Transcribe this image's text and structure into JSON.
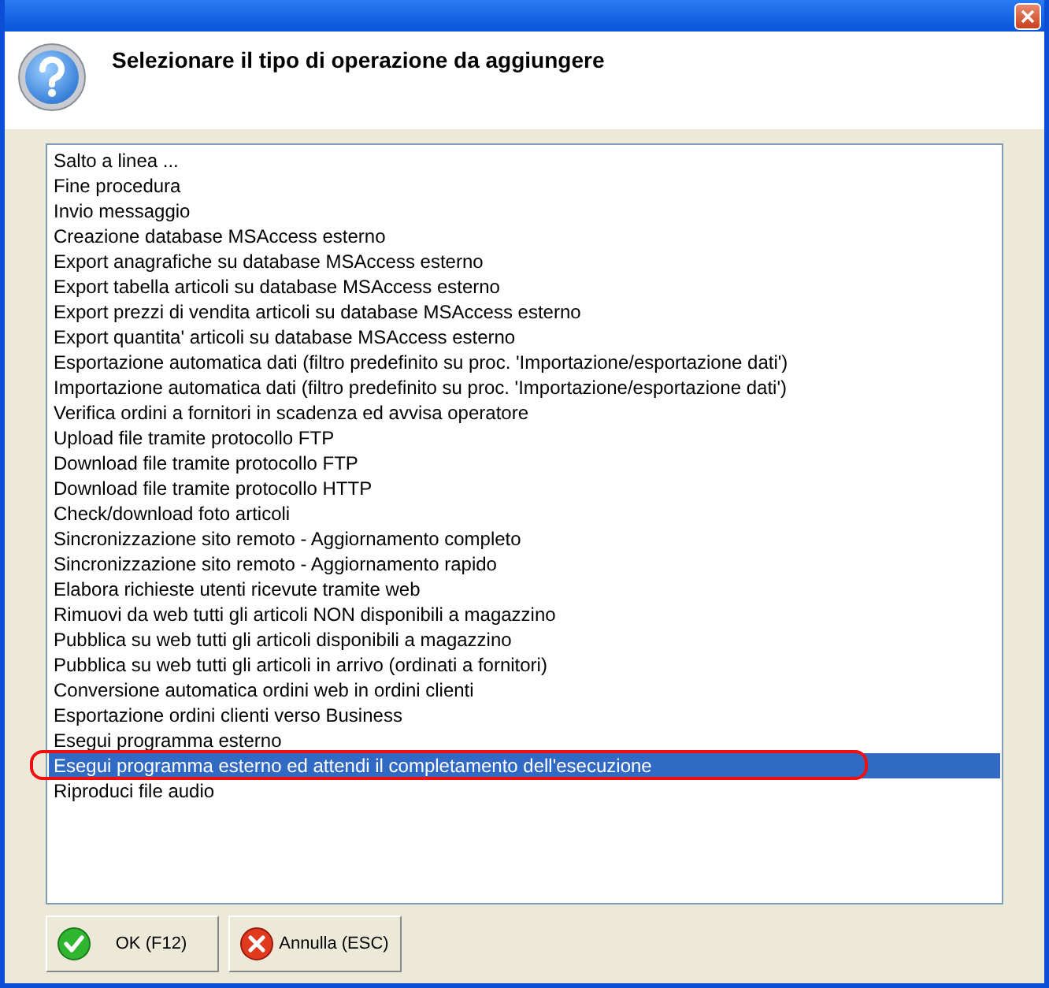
{
  "window": {
    "title": "Selezionare il tipo di operazione da aggiungere"
  },
  "operations": [
    {
      "label": "Salto a linea ...",
      "selected": false,
      "circled": false
    },
    {
      "label": "Fine procedura",
      "selected": false,
      "circled": false
    },
    {
      "label": "Invio messaggio",
      "selected": false,
      "circled": false
    },
    {
      "label": "Creazione database MSAccess esterno",
      "selected": false,
      "circled": false
    },
    {
      "label": "Export anagrafiche su database MSAccess esterno",
      "selected": false,
      "circled": false
    },
    {
      "label": "Export tabella articoli su database MSAccess esterno",
      "selected": false,
      "circled": false
    },
    {
      "label": "Export prezzi di vendita articoli su database MSAccess esterno",
      "selected": false,
      "circled": false
    },
    {
      "label": "Export quantita' articoli su database MSAccess esterno",
      "selected": false,
      "circled": false
    },
    {
      "label": "Esportazione automatica dati (filtro predefinito su proc. 'Importazione/esportazione dati')",
      "selected": false,
      "circled": false
    },
    {
      "label": "Importazione automatica dati (filtro predefinito su proc. 'Importazione/esportazione dati')",
      "selected": false,
      "circled": false
    },
    {
      "label": "Verifica ordini a fornitori in scadenza ed avvisa operatore",
      "selected": false,
      "circled": false
    },
    {
      "label": "Upload file tramite protocollo FTP",
      "selected": false,
      "circled": false
    },
    {
      "label": "Download file tramite protocollo FTP",
      "selected": false,
      "circled": false
    },
    {
      "label": "Download file tramite protocollo HTTP",
      "selected": false,
      "circled": false
    },
    {
      "label": "Check/download foto articoli",
      "selected": false,
      "circled": false
    },
    {
      "label": "Sincronizzazione sito remoto - Aggiornamento completo",
      "selected": false,
      "circled": false
    },
    {
      "label": "Sincronizzazione sito remoto - Aggiornamento rapido",
      "selected": false,
      "circled": false
    },
    {
      "label": "Elabora richieste utenti ricevute tramite web",
      "selected": false,
      "circled": false
    },
    {
      "label": "Rimuovi da web tutti gli articoli NON disponibili a magazzino",
      "selected": false,
      "circled": false
    },
    {
      "label": "Pubblica su web tutti gli articoli disponibili a magazzino",
      "selected": false,
      "circled": false
    },
    {
      "label": "Pubblica su web tutti gli articoli in arrivo (ordinati a fornitori)",
      "selected": false,
      "circled": false
    },
    {
      "label": "Conversione automatica ordini web in ordini clienti",
      "selected": false,
      "circled": false
    },
    {
      "label": "Esportazione ordini clienti verso Business",
      "selected": false,
      "circled": false
    },
    {
      "label": "Esegui programma esterno",
      "selected": false,
      "circled": false
    },
    {
      "label": "Esegui programma esterno ed attendi il completamento dell'esecuzione",
      "selected": true,
      "circled": true
    },
    {
      "label": "Riproduci file audio",
      "selected": false,
      "circled": false
    }
  ],
  "buttons": [
    {
      "label": "OK (F12)",
      "kind": "ok"
    },
    {
      "label": "Annulla (ESC)",
      "kind": "cancel"
    }
  ]
}
